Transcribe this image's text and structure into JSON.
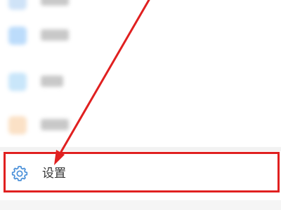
{
  "settings": {
    "label": "设置",
    "icon": "gear-icon",
    "icon_color": "#4a90d9"
  },
  "annotation": {
    "highlight_color": "#e02020",
    "arrow_color": "#e02020"
  },
  "blurred_items_icons": [
    "blue-square-icon",
    "blue-square-icon",
    "blue-square-icon",
    "orange-square-icon"
  ]
}
